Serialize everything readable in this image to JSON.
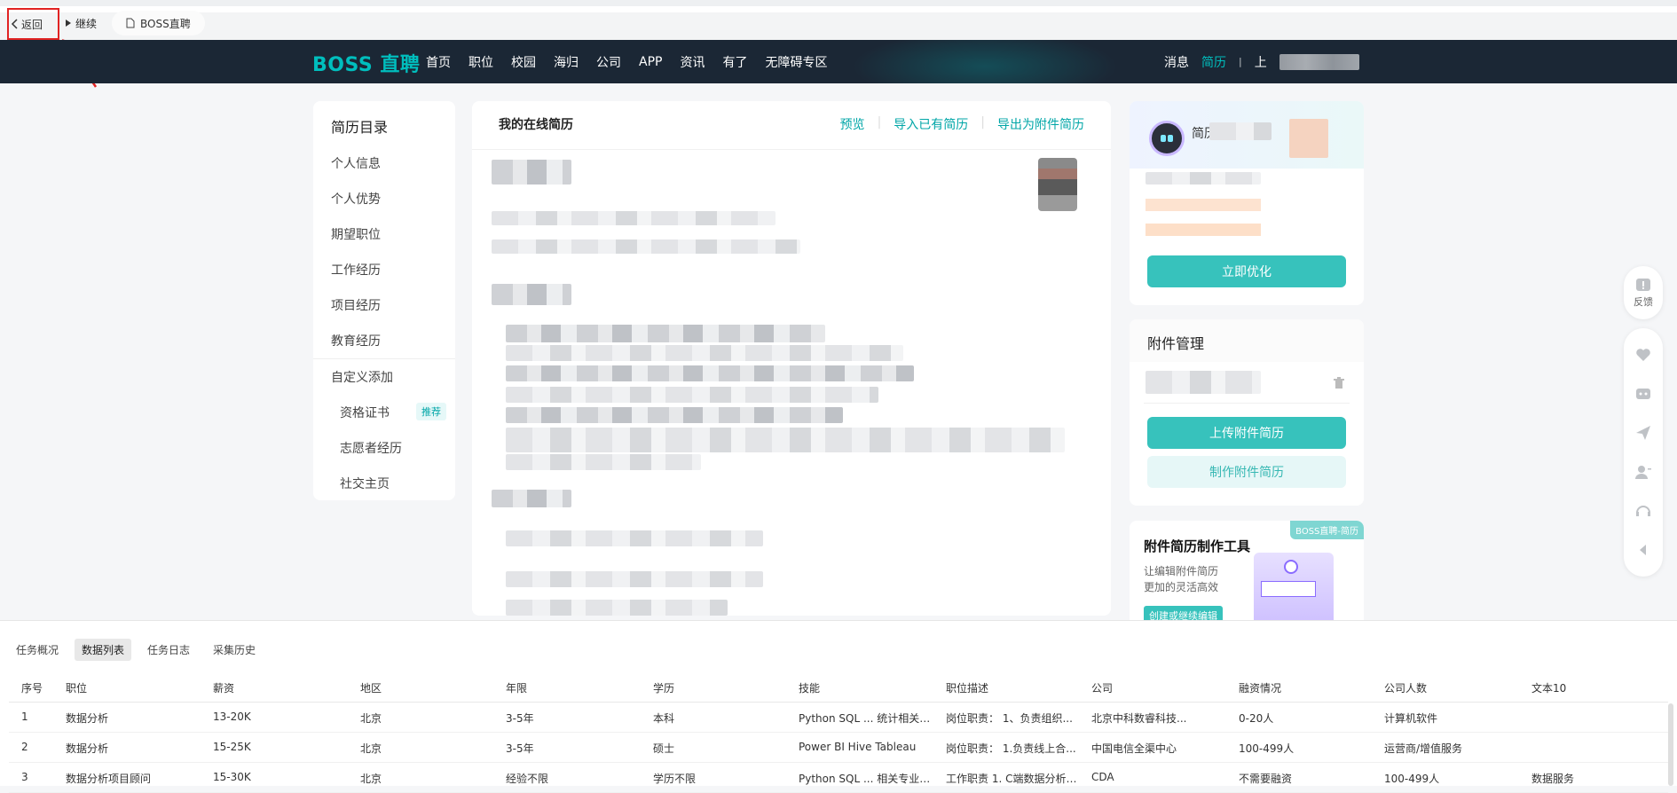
{
  "browser": {
    "back_label": "返回",
    "forward_label": "继续",
    "tab_title": "BOSS直聘"
  },
  "header": {
    "logo": "BOSS 直聘",
    "nav": [
      "首页",
      "职位",
      "校园",
      "海归",
      "公司",
      "APP",
      "资讯",
      "有了",
      "无障碍专区"
    ],
    "messages": "消息",
    "resume": "简历",
    "separator": "|",
    "upload_partial": "上"
  },
  "catalog": {
    "title": "简历目录",
    "items": [
      "个人信息",
      "个人优势",
      "期望职位",
      "工作经历",
      "项目经历",
      "教育经历"
    ],
    "custom_add": "自定义添加",
    "sub_items": [
      "资格证书",
      "志愿者经历",
      "社交主页"
    ],
    "recommend_badge": "推荐"
  },
  "resume": {
    "title": "我的在线简历",
    "preview": "预览",
    "import": "导入已有简历",
    "export": "导出为附件简历"
  },
  "ai_card": {
    "title_partial": "简历",
    "optimize_button": "立即优化"
  },
  "attach_card": {
    "title": "附件管理",
    "upload_button": "上传附件简历",
    "make_button": "制作附件简历"
  },
  "tool_card": {
    "title": "附件简历制作工具",
    "desc_line1": "让编辑附件简历",
    "desc_line2": "更加的灵活高效",
    "tag": "BOSS直聘-简历",
    "cta": "创建或继续编辑"
  },
  "side_tools": {
    "feedback_label": "反馈"
  },
  "bottom_panel": {
    "tabs": [
      "任务概况",
      "数据列表",
      "任务日志",
      "采集历史"
    ],
    "active_tab": 1,
    "columns": [
      "序号",
      "职位",
      "薪资",
      "地区",
      "年限",
      "学历",
      "技能",
      "职位描述",
      "公司",
      "融资情况",
      "公司人数",
      "文本10"
    ],
    "rows": [
      [
        "1",
        "数据分析",
        "13-20K",
        "北京",
        "3-5年",
        "本科",
        "Python SQL ... 统计相关专...",
        "岗位职责： 1、负责组织...",
        "北京中科数睿科技...",
        "0-20人",
        "计算机软件",
        ""
      ],
      [
        "2",
        "数据分析",
        "15-25K",
        "北京",
        "3-5年",
        "硕士",
        "Power BI Hive Tableau",
        "岗位职责： 1.负责线上合...",
        "中国电信全渠中心",
        "100-499人",
        "运营商/增值服务",
        ""
      ],
      [
        "3",
        "数据分析项目顾问",
        "15-30K",
        "北京",
        "经验不限",
        "学历不限",
        "Python SQL ... 相关专业 ...",
        "工作职责 1. C端数据分析/...",
        "CDA",
        "不需要融资",
        "100-499人",
        "数据服务"
      ]
    ]
  },
  "colors": {
    "brand": "#00bebd",
    "header_bg": "#1b2735",
    "button_teal": "#37c2bc",
    "annotation_red": "#e12323"
  }
}
